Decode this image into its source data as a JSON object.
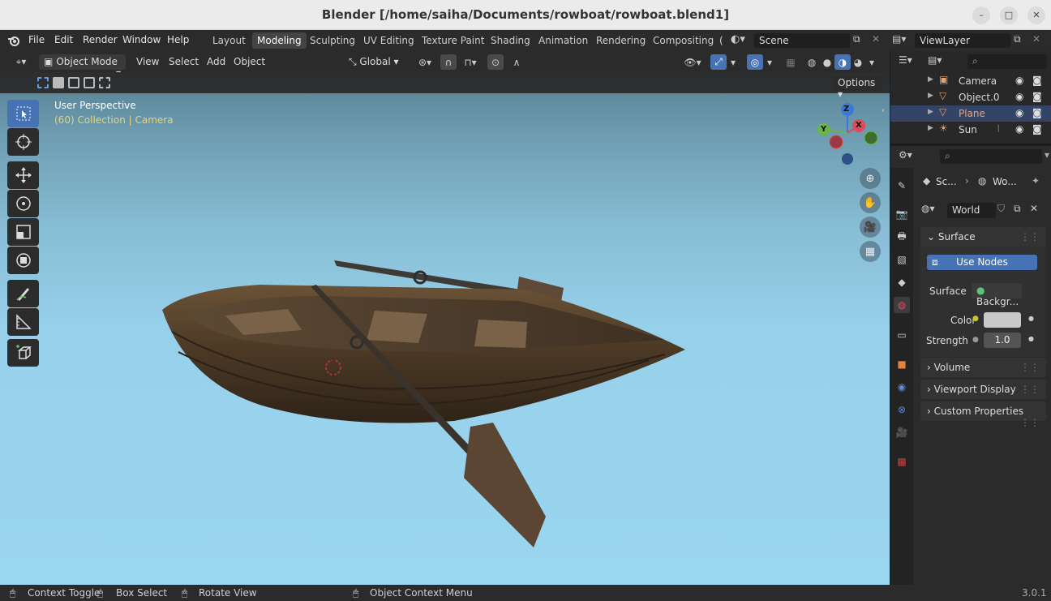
{
  "window": {
    "title": "Blender [/home/saiha/Documents/rowboat/rowboat.blend1]",
    "minimize": "–",
    "maximize": "□",
    "close": "✕"
  },
  "menu": [
    "File",
    "Edit",
    "Render",
    "Window",
    "Help"
  ],
  "workspaces": [
    "Layout",
    "Modeling",
    "Sculpting",
    "UV Editing",
    "Texture Paint",
    "Shading",
    "Animation",
    "Rendering",
    "Compositing",
    "("
  ],
  "active_workspace": "Modeling",
  "scene": {
    "label": "Scene"
  },
  "view_layer": {
    "label": "ViewLayer"
  },
  "header": {
    "mode": "Object Mode",
    "view": "View",
    "select": "Select",
    "add": "Add",
    "object": "Object",
    "orientation": "Global",
    "options": "Options"
  },
  "viewport": {
    "perspective": "User Perspective",
    "collection": "(60) Collection | Camera",
    "gizmo": {
      "z": "Z",
      "y": "Y",
      "x": "X"
    },
    "colors": {
      "accent": "#4772b3",
      "sky": "#99d6f0",
      "info_text": "#e6d27a"
    }
  },
  "outliner": {
    "items": [
      {
        "name": "Camera",
        "icon": "camera-icon",
        "selected": false
      },
      {
        "name": "Object.0",
        "icon": "mesh-icon",
        "selected": false
      },
      {
        "name": "Plane",
        "icon": "mesh-icon",
        "selected": true
      },
      {
        "name": "Sun",
        "icon": "light-icon",
        "selected": false
      }
    ]
  },
  "properties": {
    "breadcrumb": {
      "scene": "Sc...",
      "world": "Wo..."
    },
    "world_name": "World",
    "surface_panel": "Surface",
    "use_nodes": "Use Nodes",
    "surface_label": "Surface",
    "surface_value": "Backgr...",
    "color_label": "Color",
    "strength_label": "Strength",
    "strength_value": "1.0",
    "panels": [
      "Volume",
      "Viewport Display",
      "Custom Properties"
    ]
  },
  "statusbar": {
    "items": [
      "Context Toggle",
      "Box Select",
      "Rotate View",
      "Object Context Menu"
    ],
    "version": "3.0.1"
  }
}
